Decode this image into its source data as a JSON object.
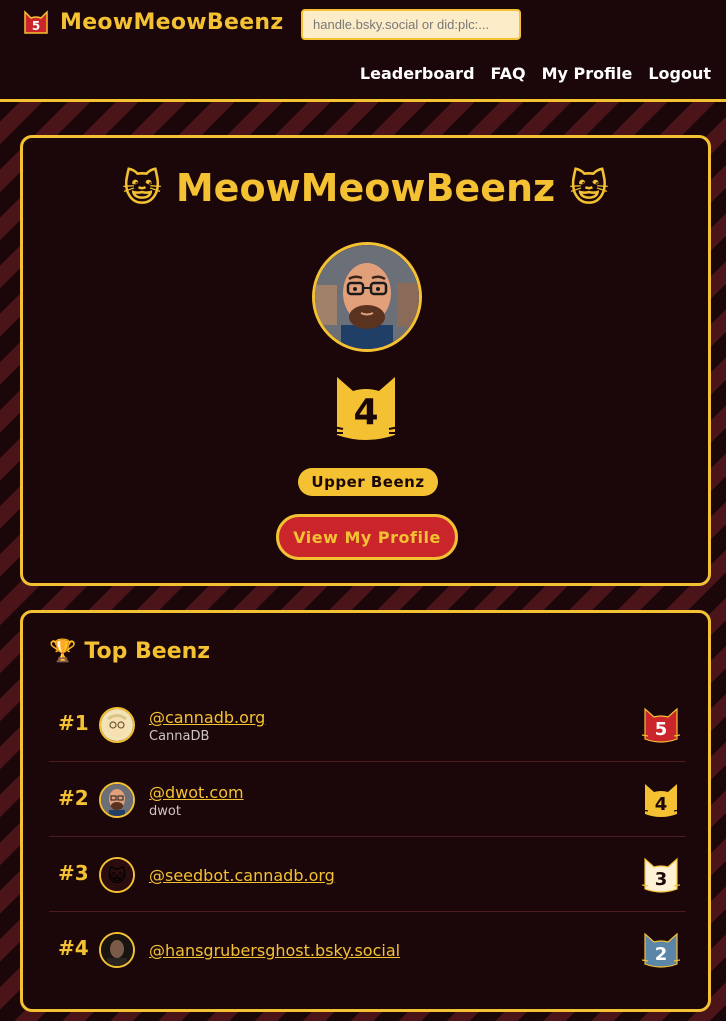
{
  "header": {
    "logo_rank": "5",
    "brand": "MeowMeowBeenz",
    "search_placeholder": "handle.bsky.social or did:plc:...",
    "nav": [
      "Leaderboard",
      "FAQ",
      "My Profile",
      "Logout"
    ]
  },
  "hero": {
    "emoji_left": "😺",
    "title": "MeowMeowBeenz",
    "emoji_right": "😺",
    "rank": "4",
    "badge": "Upper Beenz",
    "button": "View My Profile"
  },
  "leaderboard": {
    "trophy": "🏆",
    "title": "Top Beenz",
    "rows": [
      {
        "pos": "#1",
        "handle": "@cannadb.org",
        "name": "CannaDB",
        "rank": "5"
      },
      {
        "pos": "#2",
        "handle": "@dwot.com",
        "name": "dwot",
        "rank": "4"
      },
      {
        "pos": "#3",
        "handle": "@seedbot.cannadb.org",
        "name": "",
        "rank": "3"
      },
      {
        "pos": "#4",
        "handle": "@hansgrubersghost.bsky.social",
        "name": "",
        "rank": "2"
      }
    ]
  },
  "colors": {
    "accent": "#f4c133",
    "background": "#1b0709",
    "stripe": "#4a1418",
    "button_red": "#c9252b",
    "rank5": "#c9252b",
    "rank4": "#f4c133",
    "rank3": "#fdf1d6",
    "rank2": "#5b86a8"
  },
  "icons": {
    "logo": "cat-rank-icon",
    "title_left": "cat-face-icon",
    "title_right": "cat-face-icon",
    "trophy": "trophy-icon"
  }
}
